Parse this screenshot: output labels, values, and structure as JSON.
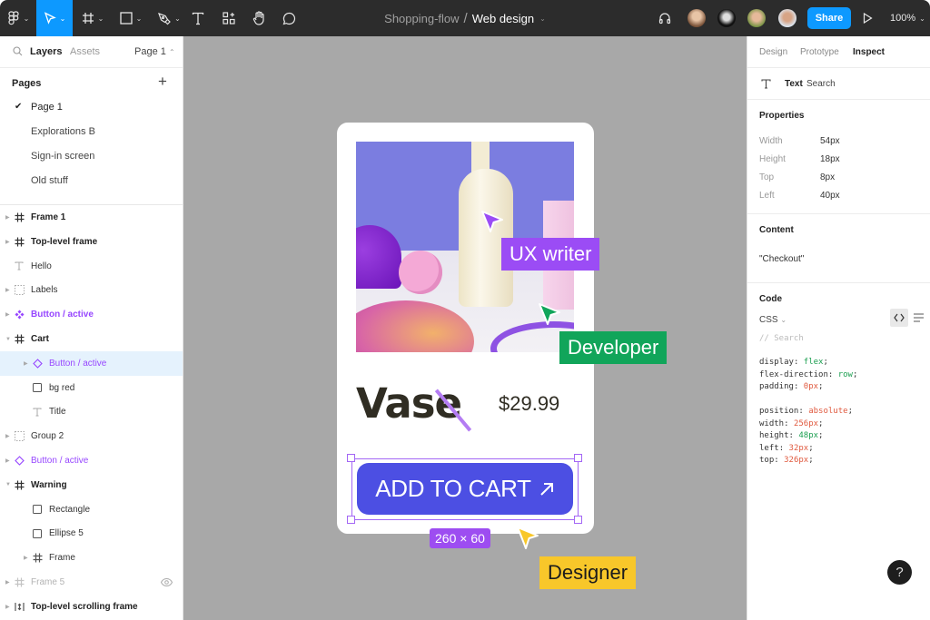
{
  "toolbar": {
    "tools": [
      {
        "name": "main-menu",
        "icon": "figma-logo-icon",
        "active": false
      },
      {
        "name": "move",
        "icon": "cursor-arrow-icon",
        "active": true
      },
      {
        "name": "frame",
        "icon": "frame-hash-icon",
        "active": false
      },
      {
        "name": "shape",
        "icon": "rectangle-icon",
        "active": false
      },
      {
        "name": "pen",
        "icon": "pen-icon",
        "active": false
      },
      {
        "name": "text",
        "icon": "text-icon",
        "active": false
      },
      {
        "name": "resources",
        "icon": "components-icon",
        "active": false
      },
      {
        "name": "hand",
        "icon": "hand-icon",
        "active": false
      },
      {
        "name": "comment",
        "icon": "comment-icon",
        "active": false
      }
    ],
    "breadcrumb": {
      "project": "Shopping-flow",
      "separator": "/",
      "file": "Web design"
    },
    "share_label": "Share",
    "zoom_level": "100%",
    "accent_color": "#0d99ff"
  },
  "left_panel": {
    "tabs": {
      "layers": "Layers",
      "assets": "Assets"
    },
    "page_selector": "Page 1",
    "pages_header": "Pages",
    "pages": [
      {
        "label": "Page 1",
        "current": true
      },
      {
        "label": "Explorations B",
        "current": false
      },
      {
        "label": "Sign-in screen",
        "current": false
      },
      {
        "label": "Old stuff",
        "current": false
      }
    ],
    "layers": [
      {
        "label": "Frame 1",
        "icon": "frame-hash-icon",
        "style": "bold",
        "depth": 0,
        "expander": "collapsed"
      },
      {
        "label": "Top-level frame",
        "icon": "frame-hash-icon",
        "style": "bold",
        "depth": 0,
        "expander": "collapsed"
      },
      {
        "label": "Hello",
        "icon": "text-icon",
        "style": "norm",
        "depth": 0,
        "expander": "none"
      },
      {
        "label": "Labels",
        "icon": "group-dashed-icon",
        "style": "norm",
        "depth": 0,
        "expander": "collapsed"
      },
      {
        "label": "Button / active",
        "icon": "component-icon",
        "style": "purple-bold",
        "depth": 0,
        "expander": "collapsed"
      },
      {
        "label": "Cart",
        "icon": "frame-hash-icon",
        "style": "bold",
        "depth": 0,
        "expander": "expanded"
      },
      {
        "label": "Button / active",
        "icon": "instance-diamond-icon",
        "style": "purple",
        "depth": 1,
        "expander": "collapsed",
        "selected": true
      },
      {
        "label": "bg red",
        "icon": "rectangle-icon",
        "style": "norm",
        "depth": 1,
        "expander": "none"
      },
      {
        "label": "Title",
        "icon": "text-icon",
        "style": "norm",
        "depth": 1,
        "expander": "none"
      },
      {
        "label": "Group 2",
        "icon": "group-dashed-icon",
        "style": "norm",
        "depth": 0,
        "expander": "collapsed"
      },
      {
        "label": "Button / active",
        "icon": "instance-diamond-icon",
        "style": "purple",
        "depth": 0,
        "expander": "collapsed"
      },
      {
        "label": "Warning",
        "icon": "frame-hash-icon",
        "style": "bold",
        "depth": 0,
        "expander": "expanded"
      },
      {
        "label": "Rectangle",
        "icon": "rectangle-icon",
        "style": "norm",
        "depth": 1,
        "expander": "none"
      },
      {
        "label": "Ellipse 5",
        "icon": "rectangle-icon",
        "style": "norm",
        "depth": 1,
        "expander": "none"
      },
      {
        "label": "Frame",
        "icon": "frame-hash-icon",
        "style": "norm",
        "depth": 1,
        "expander": "collapsed"
      },
      {
        "label": "Frame 5",
        "icon": "frame-hash-icon",
        "style": "dim",
        "depth": 0,
        "expander": "collapsed",
        "hidden": true
      },
      {
        "label": "Top-level scrolling frame",
        "icon": "scroll-frame-icon",
        "style": "bold",
        "depth": 0,
        "expander": "collapsed"
      }
    ]
  },
  "canvas": {
    "product_title": "Vase",
    "price": "$29.99",
    "cta_label": "ADD TO CART",
    "cta_icon": "arrow-up-right-icon",
    "selection_size": "260 × 60",
    "cursors": [
      {
        "label": "UX writer",
        "color": "#9b4cf5"
      },
      {
        "label": "Developer",
        "color": "#11a55a"
      },
      {
        "label": "Designer",
        "color": "#f8c72a"
      }
    ],
    "button_color": "#4c4fe3",
    "selection_color": "#a366f5"
  },
  "right_panel": {
    "tabs": {
      "design": "Design",
      "prototype": "Prototype",
      "inspect": "Inspect"
    },
    "layer_type": "Text",
    "layer_name": "Search",
    "properties_header": "Properties",
    "properties": [
      {
        "key": "Width",
        "value": "54px"
      },
      {
        "key": "Height",
        "value": "18px"
      },
      {
        "key": "Top",
        "value": "8px"
      },
      {
        "key": "Left",
        "value": "40px"
      }
    ],
    "content_header": "Content",
    "content_value": "\"Checkout\"",
    "code_header": "Code",
    "code_language": "CSS",
    "code_comment": "// Search",
    "code_block_1": [
      {
        "prop": "display",
        "value": "flex",
        "color": "green"
      },
      {
        "prop": "flex-direction",
        "value": "row",
        "color": "green"
      },
      {
        "prop": "padding",
        "value": "0px",
        "color": "red"
      }
    ],
    "code_block_2": [
      {
        "prop": "position",
        "value": "absolute",
        "color": "red"
      },
      {
        "prop": "width",
        "value": "256px",
        "color": "red"
      },
      {
        "prop": "height",
        "value": "48px",
        "color": "green"
      },
      {
        "prop": "left",
        "value": "32px",
        "color": "red"
      },
      {
        "prop": "top",
        "value": "326px",
        "color": "red"
      }
    ],
    "help_label": "?"
  }
}
